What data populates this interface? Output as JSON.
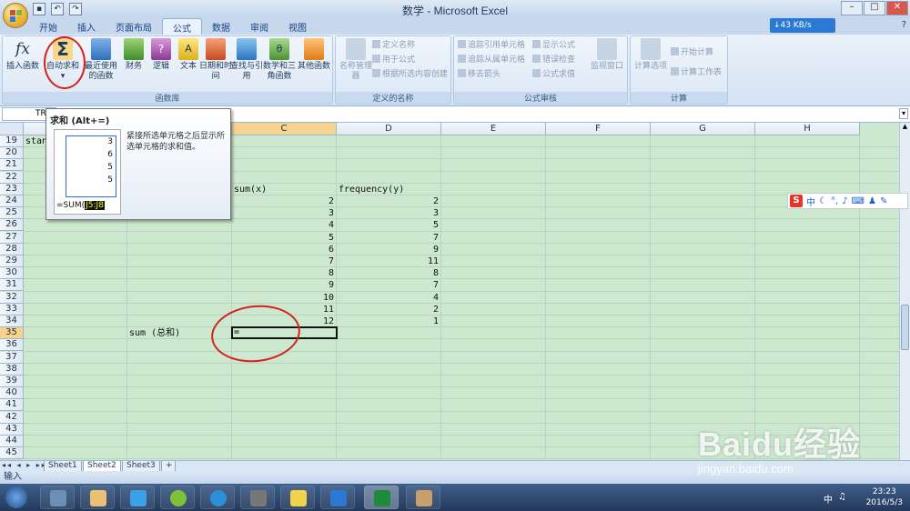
{
  "window": {
    "title": "数学 - Microsoft Excel"
  },
  "network_speed": "↓43 KB/s",
  "tabs": [
    "开始",
    "插入",
    "页面布局",
    "公式",
    "数据",
    "审阅",
    "视图"
  ],
  "active_tab": "公式",
  "ribbon": {
    "function_library": {
      "label": "函数库",
      "buttons": [
        "插入函数",
        "自动求和",
        "最近使用的函数",
        "财务",
        "逻辑",
        "文本",
        "日期和时间",
        "查找与引用",
        "数学和三角函数",
        "其他函数"
      ]
    },
    "defined_names": {
      "label": "定义的名称",
      "name_manager": "名称管理器",
      "items": [
        "定义名称",
        "用于公式",
        "根据所选内容创建"
      ]
    },
    "formula_auditing": {
      "label": "公式审核",
      "items": [
        "追踪引用单元格",
        "追踪从属单元格",
        "移去箭头",
        "显示公式",
        "错误检查",
        "公式求值"
      ],
      "watch_window": "监视窗口"
    },
    "calculation": {
      "label": "计算",
      "options": "计算选项",
      "calc_now": "开始计算",
      "calc_sheet": "计算工作表"
    }
  },
  "name_box": "TR",
  "tooltip": {
    "title": "求和 (Alt+=)",
    "description": "紧接所选单元格之后显示所选单元格的求和值。",
    "example_values": [
      "3",
      "6",
      "5",
      "5"
    ],
    "example_formula": "=SUM(",
    "example_ref": "J5:J8"
  },
  "columns": [
    "A",
    "B",
    "C",
    "D",
    "E",
    "F",
    "G",
    "H"
  ],
  "rows": [
    "19",
    "20",
    "21",
    "22",
    "23",
    "24",
    "25",
    "26",
    "27",
    "28",
    "29",
    "30",
    "31",
    "32",
    "33",
    "34",
    "35",
    "36",
    "37",
    "38",
    "39",
    "40",
    "41",
    "42",
    "43",
    "44",
    "45"
  ],
  "cells": {
    "a19": "stan",
    "c23": "sum(x)",
    "d23": "frequency(y)",
    "x_values": [
      "2",
      "3",
      "4",
      "5",
      "6",
      "7",
      "8",
      "9",
      "10",
      "11",
      "12"
    ],
    "y_values": [
      "2",
      "3",
      "5",
      "7",
      "9",
      "11",
      "8",
      "7",
      "4",
      "2",
      "1"
    ],
    "b35": "sum (总和)",
    "c35": "="
  },
  "sheets": [
    "Sheet1",
    "Sheet2",
    "Sheet3"
  ],
  "active_sheet": "Sheet2",
  "status": "输入",
  "ime": {
    "lang": "中"
  },
  "clock": {
    "time": "23:23",
    "date": "2016/5/3"
  },
  "tray_lang": "中",
  "watermark": {
    "brand": "Baidu经验",
    "url": "jingyan.baidu.com"
  },
  "colors": {
    "accent": "#2b79d2",
    "grid_bg": "#cce8cf",
    "annotation": "#d8201a"
  }
}
